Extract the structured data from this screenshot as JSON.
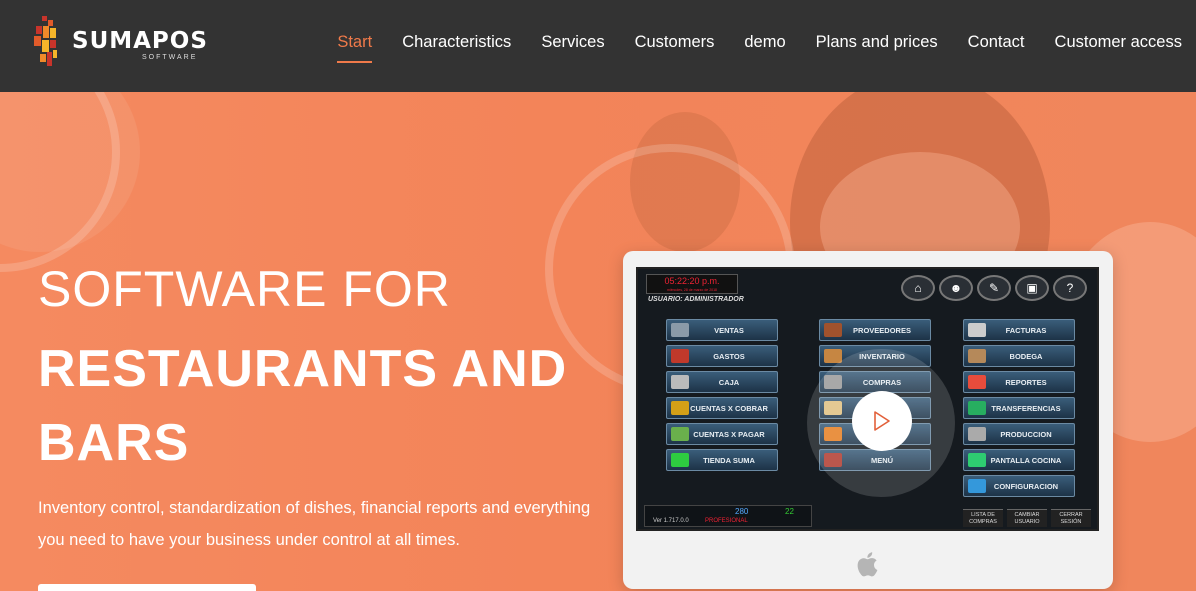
{
  "brand": {
    "name": "SUMAPOS",
    "sub": "SOFTWARE"
  },
  "nav": {
    "items": [
      {
        "label": "Start",
        "active": true
      },
      {
        "label": "Characteristics"
      },
      {
        "label": "Services"
      },
      {
        "label": "Customers"
      },
      {
        "label": "demo"
      },
      {
        "label": "Plans and prices"
      },
      {
        "label": "Contact"
      },
      {
        "label": "Customer access"
      }
    ]
  },
  "hero": {
    "line1": "SOFTWARE FOR",
    "line2": "RESTAURANTS AND BARS",
    "subtitle": "Inventory control, standardization of dishes, financial reports and everything you need to have your business under control at all times."
  },
  "screen": {
    "clock": "05:22:20 p.m.",
    "date": "miércoles, 28 de marzo de 2018",
    "user": "USUARIO:      ADMINISTRADOR",
    "col1": [
      "VENTAS",
      "GASTOS",
      "CAJA",
      "CUENTAS X COBRAR",
      "CUENTAS X PAGAR",
      "TIENDA SUMA"
    ],
    "col2": [
      "PROVEEDORES",
      "INVENTARIO",
      "COMPRAS",
      "PEDIDOS",
      "CLIENTES",
      "MENÚ"
    ],
    "col3": [
      "FACTURAS",
      "BODEGA",
      "REPORTES",
      "TRANSFERENCIAS",
      "PRODUCCION",
      "PANTALLA COCINA",
      "CONFIGURACION"
    ],
    "status": {
      "version": "Ver 1.717.0.0",
      "left_value": "280",
      "right_value": "22",
      "mode": "PROFESIONAL"
    },
    "bottom": [
      "LISTA DE COMPRAS",
      "CAMBIAR USUARIO",
      "CERRAR SESIÓN"
    ]
  },
  "colors": {
    "accent": "#f07a4a",
    "nav_bg": "#333333",
    "hero_bg": "#f38459"
  }
}
